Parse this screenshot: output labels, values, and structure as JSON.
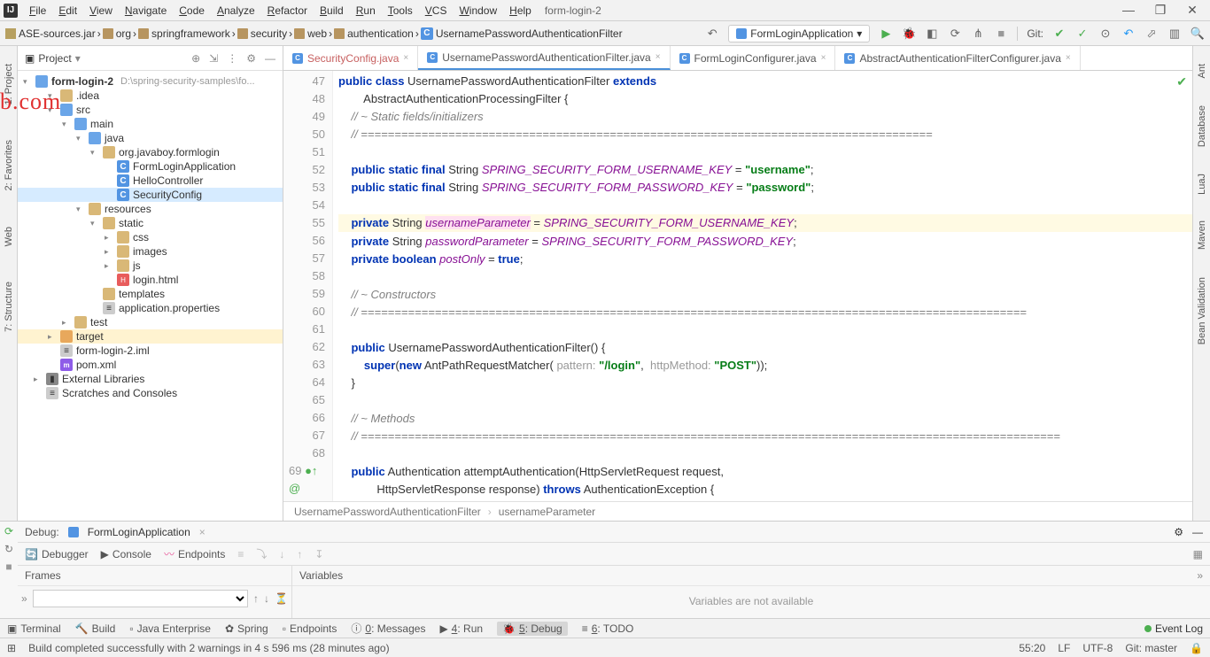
{
  "window": {
    "title": "form-login-2"
  },
  "menu": [
    "File",
    "Edit",
    "View",
    "Navigate",
    "Code",
    "Analyze",
    "Refactor",
    "Build",
    "Run",
    "Tools",
    "VCS",
    "Window",
    "Help"
  ],
  "window_controls": {
    "minimize": "—",
    "maximize": "❐",
    "close": "✕"
  },
  "breadcrumbs": [
    {
      "icon": "lib-folder",
      "text": "ASE-sources.jar"
    },
    {
      "icon": "folder",
      "text": "org"
    },
    {
      "icon": "folder",
      "text": "springframework"
    },
    {
      "icon": "folder",
      "text": "security"
    },
    {
      "icon": "folder",
      "text": "web"
    },
    {
      "icon": "folder",
      "text": "authentication"
    },
    {
      "icon": "class",
      "text": "UsernamePasswordAuthenticationFilter"
    }
  ],
  "run_config": "FormLoginApplication",
  "git_branch": "master",
  "project_panel": {
    "title": "Project",
    "root": "form-login-2",
    "root_path": "D:\\spring-security-samples\\fo...",
    "nodes": [
      {
        "depth": 1,
        "arrow": "v",
        "icon": "folder",
        "label": ".idea"
      },
      {
        "depth": 1,
        "arrow": "v",
        "icon": "folder-blue",
        "label": "src"
      },
      {
        "depth": 2,
        "arrow": "v",
        "icon": "folder-blue",
        "label": "main"
      },
      {
        "depth": 3,
        "arrow": "v",
        "icon": "folder-blue",
        "label": "java"
      },
      {
        "depth": 4,
        "arrow": "v",
        "icon": "folder",
        "label": "org.javaboy.formlogin"
      },
      {
        "depth": 5,
        "arrow": "",
        "icon": "class",
        "label": "FormLoginApplication"
      },
      {
        "depth": 5,
        "arrow": "",
        "icon": "class",
        "label": "HelloController"
      },
      {
        "depth": 5,
        "arrow": "",
        "icon": "class",
        "label": "SecurityConfig",
        "sel": true
      },
      {
        "depth": 3,
        "arrow": "v",
        "icon": "folder",
        "label": "resources"
      },
      {
        "depth": 4,
        "arrow": "v",
        "icon": "folder",
        "label": "static"
      },
      {
        "depth": 5,
        "arrow": ">",
        "icon": "folder",
        "label": "css"
      },
      {
        "depth": 5,
        "arrow": ">",
        "icon": "folder",
        "label": "images"
      },
      {
        "depth": 5,
        "arrow": ">",
        "icon": "folder",
        "label": "js"
      },
      {
        "depth": 5,
        "arrow": "",
        "icon": "html",
        "label": "login.html"
      },
      {
        "depth": 4,
        "arrow": "",
        "icon": "folder",
        "label": "templates"
      },
      {
        "depth": 4,
        "arrow": "",
        "icon": "file",
        "label": "application.properties"
      },
      {
        "depth": 2,
        "arrow": ">",
        "icon": "folder",
        "label": "test"
      },
      {
        "depth": 1,
        "arrow": ">",
        "icon": "folder-orange",
        "label": "target",
        "sel2": true
      },
      {
        "depth": 1,
        "arrow": "",
        "icon": "file",
        "label": "form-login-2.iml"
      },
      {
        "depth": 1,
        "arrow": "",
        "icon": "xml",
        "label": "pom.xml"
      },
      {
        "depth": 0,
        "arrow": ">",
        "icon": "lib",
        "label": "External Libraries"
      },
      {
        "depth": 0,
        "arrow": "",
        "icon": "file",
        "label": "Scratches and Consoles"
      }
    ]
  },
  "editor_tabs": [
    {
      "label": "SecurityConfig.java",
      "active": false,
      "modified": false,
      "color": "#c76060"
    },
    {
      "label": "UsernamePasswordAuthenticationFilter.java",
      "active": true
    },
    {
      "label": "FormLoginConfigurer.java",
      "active": false
    },
    {
      "label": "AbstractAuthenticationFilterConfigurer.java",
      "active": false
    }
  ],
  "code": {
    "first_line": 47,
    "caret_line": 55,
    "lines": [
      {
        "n": 47,
        "html": "<span class='kw'>public class</span> UsernamePasswordAuthenticationFilter <span class='kw'>extends</span>"
      },
      {
        "n": 48,
        "html": "        AbstractAuthenticationProcessingFilter {"
      },
      {
        "n": 49,
        "html": "    <span class='com'>// ~ Static fields/initializers</span>"
      },
      {
        "n": 50,
        "html": "    <span class='com'>// =====================================================================================</span>"
      },
      {
        "n": 51,
        "html": ""
      },
      {
        "n": 52,
        "html": "    <span class='kw'>public static final</span> String <span class='const'>SPRING_SECURITY_FORM_USERNAME_KEY</span> = <span class='str'>\"username\"</span>;"
      },
      {
        "n": 53,
        "html": "    <span class='kw'>public static final</span> String <span class='const'>SPRING_SECURITY_FORM_PASSWORD_KEY</span> = <span class='str'>\"password\"</span>;"
      },
      {
        "n": 54,
        "html": ""
      },
      {
        "n": 55,
        "html": "    <span class='kw'>private</span> String <span class='field sel-word'>usernameParameter</span> = <span class='const'>SPRING_SECURITY_FORM_USERNAME_KEY</span>;",
        "hl": true
      },
      {
        "n": 56,
        "html": "    <span class='kw'>private</span> String <span class='field'>passwordParameter</span> = <span class='const'>SPRING_SECURITY_FORM_PASSWORD_KEY</span>;"
      },
      {
        "n": 57,
        "html": "    <span class='kw'>private boolean</span> <span class='field'>postOnly</span> = <span class='kw'>true</span>;"
      },
      {
        "n": 58,
        "html": ""
      },
      {
        "n": 59,
        "html": "    <span class='com'>// ~ Constructors</span>"
      },
      {
        "n": 60,
        "html": "    <span class='com'>// ===================================================================================================</span>"
      },
      {
        "n": 61,
        "html": ""
      },
      {
        "n": 62,
        "html": "    <span class='kw'>public</span> UsernamePasswordAuthenticationFilter() {"
      },
      {
        "n": 63,
        "html": "        <span class='kw'>super</span>(<span class='kw'>new</span> AntPathRequestMatcher( <span class='hint'>pattern:</span> <span class='str'>\"/login\"</span>,  <span class='hint'>httpMethod:</span> <span class='str'>\"POST\"</span>));"
      },
      {
        "n": 64,
        "html": "    }"
      },
      {
        "n": 65,
        "html": ""
      },
      {
        "n": 66,
        "html": "    <span class='com'>// ~ Methods</span>"
      },
      {
        "n": 67,
        "html": "    <span class='com'>// ========================================================================================================</span>"
      },
      {
        "n": 68,
        "html": ""
      },
      {
        "n": 69,
        "html": "    <span class='kw'>public</span> Authentication attemptAuthentication(HttpServletRequest request,",
        "marker": "●↑ @"
      },
      {
        "n": 70,
        "html": "            HttpServletResponse response) <span class='kw'>throws</span> AuthenticationException {"
      }
    ],
    "crumb": [
      "UsernamePasswordAuthenticationFilter",
      "usernameParameter"
    ]
  },
  "left_rail": [
    "1: Project",
    "2: Favorites",
    "Web",
    "7: Structure"
  ],
  "right_rail": [
    "Ant",
    "Database",
    "LuaJ",
    "Maven",
    "Bean Validation"
  ],
  "debug": {
    "title": "Debug:",
    "target": "FormLoginApplication",
    "sub_tabs": [
      "Debugger",
      "Console",
      "Endpoints"
    ],
    "frames_title": "Frames",
    "vars_title": "Variables",
    "vars_msg": "Variables are not available"
  },
  "toolwindows": [
    {
      "label": "Terminal"
    },
    {
      "label": "Build"
    },
    {
      "label": "Java Enterprise"
    },
    {
      "label": "Spring"
    },
    {
      "label": "Endpoints"
    },
    {
      "label": "0: Messages"
    },
    {
      "label": "4: Run"
    },
    {
      "label": "5: Debug",
      "active": true
    },
    {
      "label": "6: TODO"
    }
  ],
  "event_log": "Event Log",
  "status": {
    "msg": "Build completed successfully with 2 warnings in 4 s 596 ms (28 minutes ago)",
    "pos": "55:20",
    "le": "LF",
    "enc": "UTF-8",
    "git": "Git: master"
  },
  "watermark": "b.com"
}
